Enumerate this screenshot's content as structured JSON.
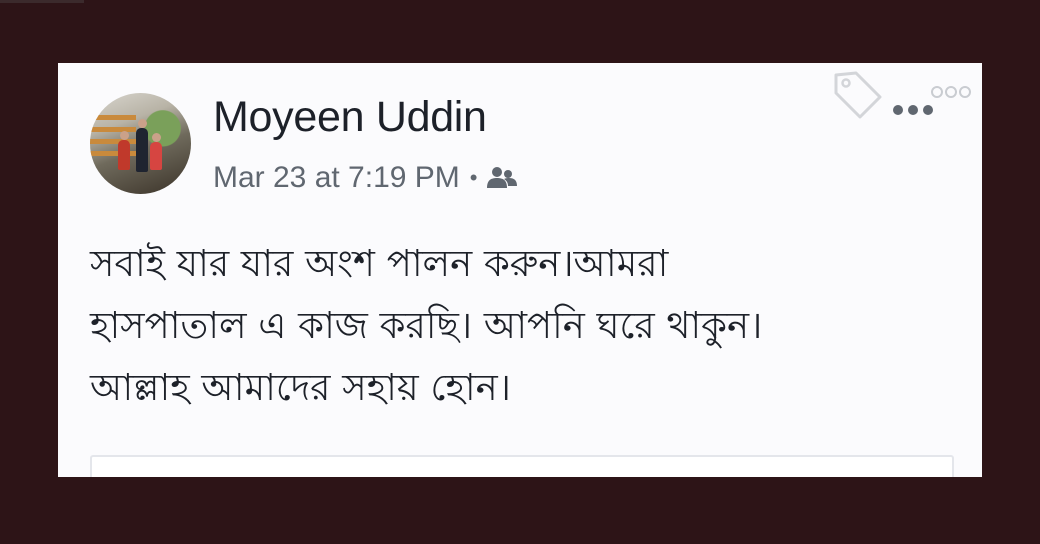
{
  "post": {
    "author": "Moyeen Uddin",
    "timestamp": "Mar 23 at 7:19 PM",
    "separator": "•",
    "audience_icon": "friends-icon",
    "text_lines": [
      "সবাই যার যার অংশ পালন করুন।আমরা",
      "হাসপাতাল এ কাজ করছি। আপনি ঘরে থাকুন।",
      "আল্লাহ আমাদের সহায় হোন।"
    ]
  },
  "icons": {
    "tag": "tag-icon",
    "more": "more-options-icon"
  },
  "colors": {
    "background": "#2d1417",
    "card": "#fbfbfd",
    "name": "#1d2129",
    "meta": "#606770"
  }
}
